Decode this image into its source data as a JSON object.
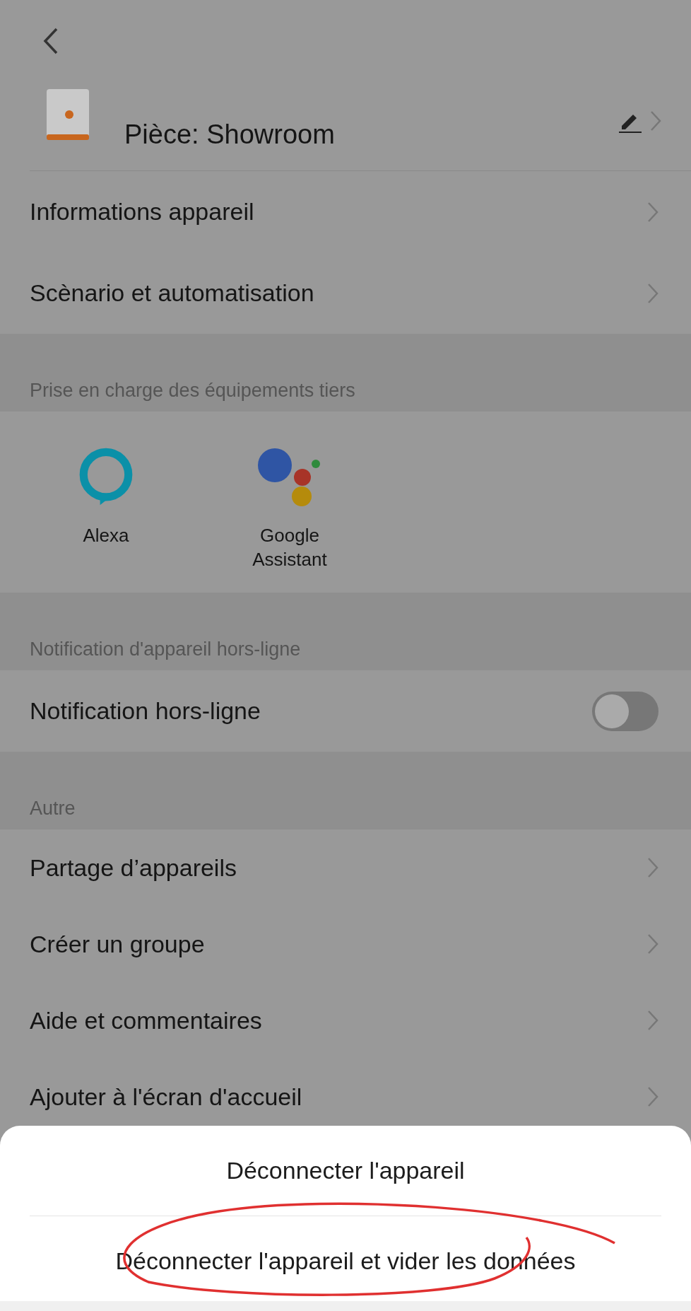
{
  "device": {
    "room": "Pièce: Showroom"
  },
  "menu": [
    {
      "label": "Informations appareil"
    },
    {
      "label": "Scènario et automatisation"
    }
  ],
  "third_party": {
    "title": "Prise en charge des équipements tiers",
    "services": [
      {
        "name": "Alexa",
        "kind": "alexa"
      },
      {
        "name": "Google Assistant",
        "kind": "google"
      }
    ]
  },
  "offline": {
    "title": "Notification d'appareil hors-ligne",
    "label": "Notification hors-ligne",
    "on": false
  },
  "other": {
    "title": "Autre",
    "items": [
      {
        "label": "Partage d’appareils"
      },
      {
        "label": "Créer un groupe"
      },
      {
        "label": "Aide et commentaires"
      },
      {
        "label": "Ajouter à l'écran d'accueil"
      }
    ]
  },
  "sheet": {
    "options": [
      {
        "label": "Déconnecter l'appareil"
      },
      {
        "label": "Déconnecter l'appareil et vider les données"
      }
    ]
  }
}
